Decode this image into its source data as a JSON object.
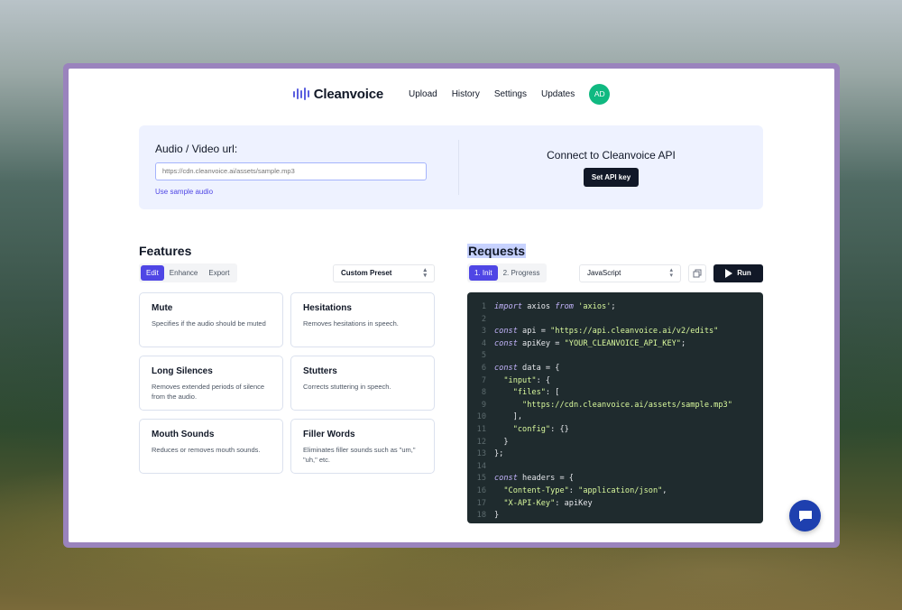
{
  "nav": {
    "logo_text": "Cleanvoice",
    "links": [
      "Upload",
      "History",
      "Settings",
      "Updates"
    ],
    "avatar_initials": "AD",
    "avatar_color": "#10b981"
  },
  "top_panel": {
    "url_label": "Audio / Video url:",
    "url_placeholder": "https://cdn.cleanvoice.ai/assets/sample.mp3",
    "sample_link": "Use sample audio",
    "api_title": "Connect to Cleanvoice API",
    "api_button": "Set API key"
  },
  "features": {
    "title": "Features",
    "tabs": [
      "Edit",
      "Enhance",
      "Export"
    ],
    "active_tab": "Edit",
    "preset_select": "Custom Preset",
    "cards": [
      {
        "title": "Mute",
        "desc": "Specifies if the audio should be muted"
      },
      {
        "title": "Hesitations",
        "desc": "Removes hesitations in speech."
      },
      {
        "title": "Long Silences",
        "desc": "Removes extended periods of silence from the audio."
      },
      {
        "title": "Stutters",
        "desc": "Corrects stuttering in speech."
      },
      {
        "title": "Mouth Sounds",
        "desc": "Reduces or removes mouth sounds."
      },
      {
        "title": "Filler Words",
        "desc": "Eliminates filler sounds such as \"um,\" \"uh,\" etc."
      }
    ]
  },
  "requests": {
    "title": "Requests",
    "tabs": [
      "1. Init",
      "2. Progress"
    ],
    "active_tab": "1. Init",
    "language_select": "JavaScript",
    "run_button": "Run",
    "code_lines": [
      "import axios from 'axios';",
      "",
      "const api = \"https://api.cleanvoice.ai/v2/edits\"",
      "const apiKey = \"YOUR_CLEANVOICE_API_KEY\";",
      "",
      "const data = {",
      "  \"input\": {",
      "    \"files\": [",
      "      \"https://cdn.cleanvoice.ai/assets/sample.mp3\"",
      "    ],",
      "    \"config\": {}",
      "  }",
      "};",
      "",
      "const headers = {",
      "  \"Content-Type\": \"application/json\",",
      "  \"X-API-Key\": apiKey",
      "}"
    ]
  },
  "colors": {
    "accent": "#4f46e5",
    "dark": "#111827",
    "panel": "#eef2ff",
    "code_bg": "#1f2b2e",
    "chat": "#1e40af"
  }
}
